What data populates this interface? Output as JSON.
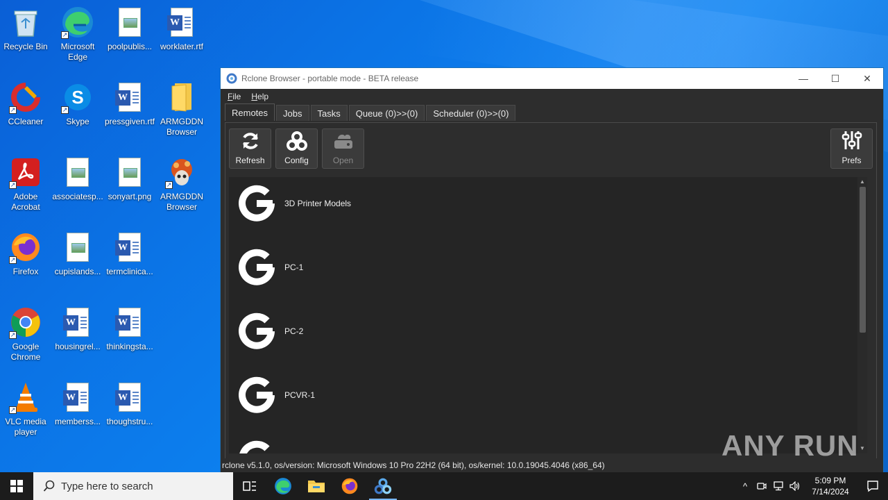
{
  "desktop": {
    "icons": [
      {
        "label": "Recycle Bin",
        "icon": "recycle-bin-icon"
      },
      {
        "label": "Microsoft Edge",
        "icon": "edge-icon"
      },
      {
        "label": "poolpublis...",
        "icon": "image-file-icon"
      },
      {
        "label": "worklater.rtf",
        "icon": "word-file-icon"
      },
      {
        "label": "CCleaner",
        "icon": "ccleaner-icon"
      },
      {
        "label": "Skype",
        "icon": "skype-icon"
      },
      {
        "label": "pressgiven.rtf",
        "icon": "word-file-icon"
      },
      {
        "label": "ARMGDDN Browser",
        "icon": "folder-icon"
      },
      {
        "label": "Adobe Acrobat",
        "icon": "acrobat-icon"
      },
      {
        "label": "associatesp...",
        "icon": "image-file-icon"
      },
      {
        "label": "sonyart.png",
        "icon": "image-file-icon"
      },
      {
        "label": "ARMGDDN Browser",
        "icon": "armgddn-icon"
      },
      {
        "label": "Firefox",
        "icon": "firefox-icon"
      },
      {
        "label": "cupislands...",
        "icon": "image-file-icon"
      },
      {
        "label": "termclinica...",
        "icon": "word-file-icon"
      },
      {
        "label": "Google Chrome",
        "icon": "chrome-icon"
      },
      {
        "label": "housingrel...",
        "icon": "word-file-icon"
      },
      {
        "label": "thinkingsta...",
        "icon": "word-file-icon"
      },
      {
        "label": "VLC media player",
        "icon": "vlc-icon"
      },
      {
        "label": "memberss...",
        "icon": "word-file-icon"
      },
      {
        "label": "thoughstru...",
        "icon": "word-file-icon"
      }
    ]
  },
  "window": {
    "title": "Rclone Browser - portable mode - BETA release",
    "menu": {
      "file": "F",
      "file_rest": "ile",
      "help": "H",
      "help_rest": "elp"
    },
    "tabs": [
      "Remotes",
      "Jobs",
      "Tasks",
      "Queue (0)>>(0)",
      "Scheduler (0)>>(0)"
    ],
    "toolbar": {
      "refresh": "Refresh",
      "config": "Config",
      "open": "Open",
      "prefs": "Prefs"
    },
    "remotes": [
      "3D Printer Models",
      "PC-1",
      "PC-2",
      "PCVR-1",
      ""
    ],
    "status": "rclone v5.1.0, os/version: Microsoft Windows 10 Pro 22H2 (64 bit), os/kernel: 10.0.19045.4046 (x86_64)"
  },
  "watermark": "ANY RUN",
  "taskbar": {
    "search_placeholder": "Type here to search",
    "time": "5:09 PM",
    "date": "7/14/2024"
  }
}
